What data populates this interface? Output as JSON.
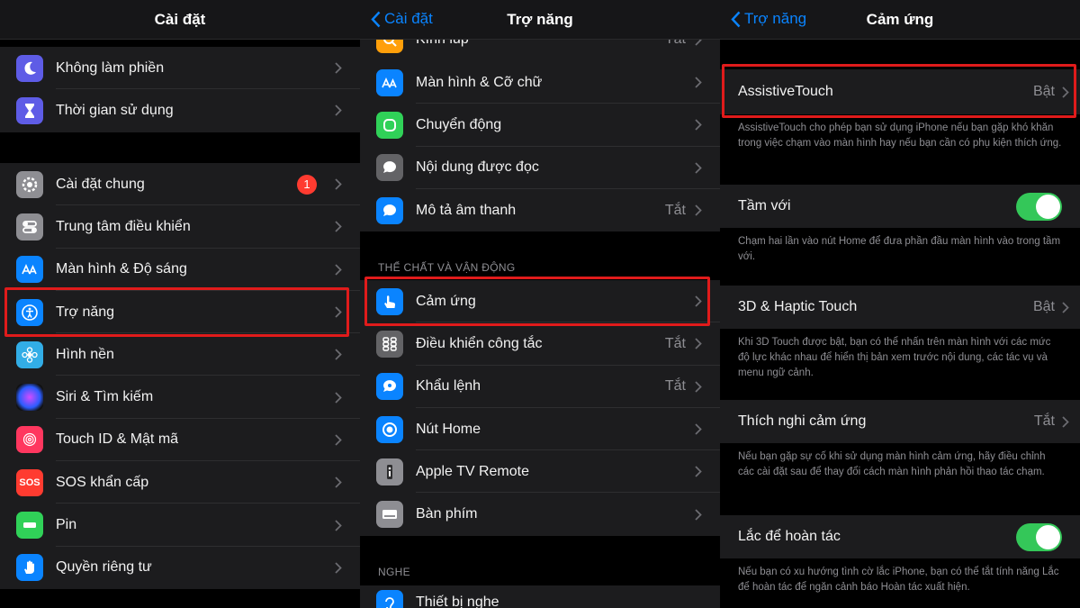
{
  "panels": {
    "settings": {
      "title": "Cài đặt",
      "group1": [
        {
          "label": "Không làm phiền",
          "icon": "moon-icon",
          "color": "#5e5ce6"
        },
        {
          "label": "Thời gian sử dụng",
          "icon": "hourglass-icon",
          "color": "#5e5ce6"
        }
      ],
      "group2": [
        {
          "label": "Cài đặt chung",
          "icon": "gear-icon",
          "color": "#8e8e93",
          "badge": "1"
        },
        {
          "label": "Trung tâm điều khiển",
          "icon": "switches-icon",
          "color": "#8e8e93"
        },
        {
          "label": "Màn hình & Độ sáng",
          "icon": "display-aa-icon",
          "color": "#0a84ff"
        },
        {
          "label": "Trợ năng",
          "icon": "accessibility-icon",
          "color": "#0a84ff"
        },
        {
          "label": "Hình nền",
          "icon": "flower-icon",
          "color": "#32ade6"
        },
        {
          "label": "Siri & Tìm kiếm",
          "icon": "siri-icon",
          "color": "#222"
        },
        {
          "label": "Touch ID & Mật mã",
          "icon": "fingerprint-icon",
          "color": "#ff375f"
        },
        {
          "label": "SOS khẩn cấp",
          "icon": "sos-icon",
          "color": "#ff3b30",
          "icon_text": "SOS"
        },
        {
          "label": "Pin",
          "icon": "battery-icon",
          "color": "#30d158"
        },
        {
          "label": "Quyền riêng tư",
          "icon": "hand-icon",
          "color": "#0a84ff"
        }
      ]
    },
    "accessibility": {
      "title": "Trợ năng",
      "back": "Cài đặt",
      "top_partial": {
        "label": "Kính lúp",
        "value": "Tắt"
      },
      "group1": [
        {
          "label": "Màn hình & Cỡ chữ",
          "icon": "display-aa-icon",
          "color": "#0a84ff"
        },
        {
          "label": "Chuyển động",
          "icon": "motion-icon",
          "color": "#30d158"
        },
        {
          "label": "Nội dung được đọc",
          "icon": "speech-icon",
          "color": "#636366"
        },
        {
          "label": "Mô tả âm thanh",
          "icon": "audio-description-icon",
          "color": "#0a84ff",
          "value": "Tắt"
        }
      ],
      "section_physical": "THỂ CHẤT VÀ VẬN ĐỘNG",
      "group2": [
        {
          "label": "Cảm ứng",
          "icon": "touch-hand-icon",
          "color": "#0a84ff"
        },
        {
          "label": "Điều khiển công tắc",
          "icon": "grid-icon",
          "color": "#636366",
          "value": "Tắt"
        },
        {
          "label": "Khẩu lệnh",
          "icon": "voice-control-icon",
          "color": "#0a84ff",
          "value": "Tắt"
        },
        {
          "label": "Nút Home",
          "icon": "home-button-icon",
          "color": "#0a84ff"
        },
        {
          "label": "Apple TV Remote",
          "icon": "remote-icon",
          "color": "#8e8e93"
        },
        {
          "label": "Bàn phím",
          "icon": "keyboard-icon",
          "color": "#8e8e93"
        }
      ],
      "section_hearing": "NGHE",
      "bottom_partial": {
        "label": "Thiết bị nghe",
        "icon": "ear-icon",
        "color": "#0a84ff"
      }
    },
    "touch": {
      "title": "Cảm ứng",
      "back": "Trợ năng",
      "assistive": {
        "label": "AssistiveTouch",
        "value": "Bật"
      },
      "assistive_footer": "AssistiveTouch cho phép bạn sử dụng iPhone nếu bạn gặp khó khăn trong việc chạm vào màn hình hay nếu bạn cần có phụ kiện thích ứng.",
      "reach": {
        "label": "Tầm với",
        "on": true
      },
      "reach_footer": "Chạm hai lần vào nút Home để đưa phần đầu màn hình vào trong tầm với.",
      "haptic": {
        "label": "3D & Haptic Touch",
        "value": "Bật"
      },
      "haptic_footer": "Khi 3D Touch được bật, bạn có thể nhấn trên màn hình với các mức độ lực khác nhau để hiển thị bản xem trước nội dung, các tác vụ và menu ngữ cảnh.",
      "accommodations": {
        "label": "Thích nghi cảm ứng",
        "value": "Tắt"
      },
      "accommodations_footer": "Nếu bạn gặp sự cố khi sử dụng màn hình cảm ứng, hãy điều chỉnh các cài đặt sau để thay đổi cách màn hình phản hồi thao tác chạm.",
      "shake": {
        "label": "Lắc để hoàn tác",
        "on": true
      },
      "shake_footer": "Nếu bạn có xu hướng tình cờ lắc iPhone, bạn có thể tắt tính năng Lắc để hoàn tác để ngăn cảnh báo Hoàn tác xuất hiện."
    }
  },
  "colors": {
    "highlight": "#e01b1b",
    "accent": "#0a84ff",
    "toggle_on": "#34c759"
  }
}
